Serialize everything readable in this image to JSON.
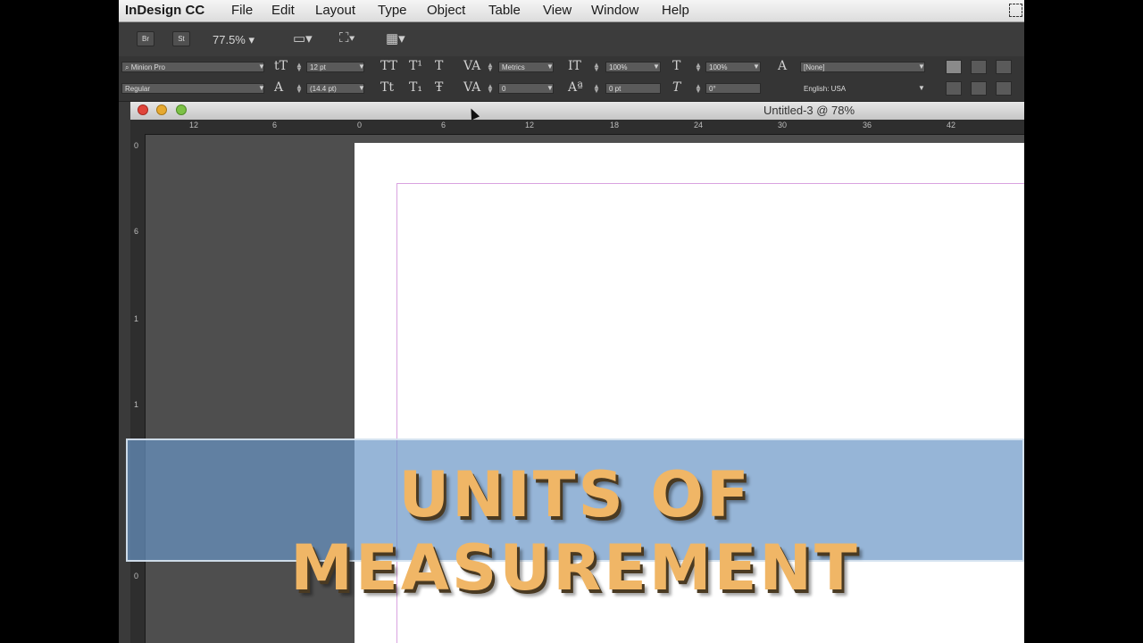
{
  "menubar": {
    "app_name": "InDesign CC",
    "items": [
      "File",
      "Edit",
      "Layout",
      "Type",
      "Object",
      "Table",
      "View",
      "Window",
      "Help"
    ]
  },
  "appbar": {
    "bridge_label": "Br",
    "stock_label": "St",
    "zoom": "77.5%"
  },
  "control": {
    "font_family": "Minion Pro",
    "font_style": "Regular",
    "font_size": "12 pt",
    "leading": "(14.4 pt)",
    "kerning": "Metrics",
    "tracking": "0",
    "vertical_scale": "100%",
    "baseline_shift": "0 pt",
    "horizontal_scale": "100%",
    "skew": "0°",
    "char_style": "[None]",
    "language": "English: USA"
  },
  "document": {
    "title": "Untitled-3 @ 78%",
    "hruler_labels": [
      "12",
      "6",
      "0",
      "6",
      "12",
      "18",
      "24",
      "30",
      "36",
      "42"
    ],
    "vruler_labels": [
      "0",
      "6",
      "1",
      "1",
      "0"
    ]
  },
  "banner": {
    "title": "UNITS OF MEASUREMENT"
  }
}
